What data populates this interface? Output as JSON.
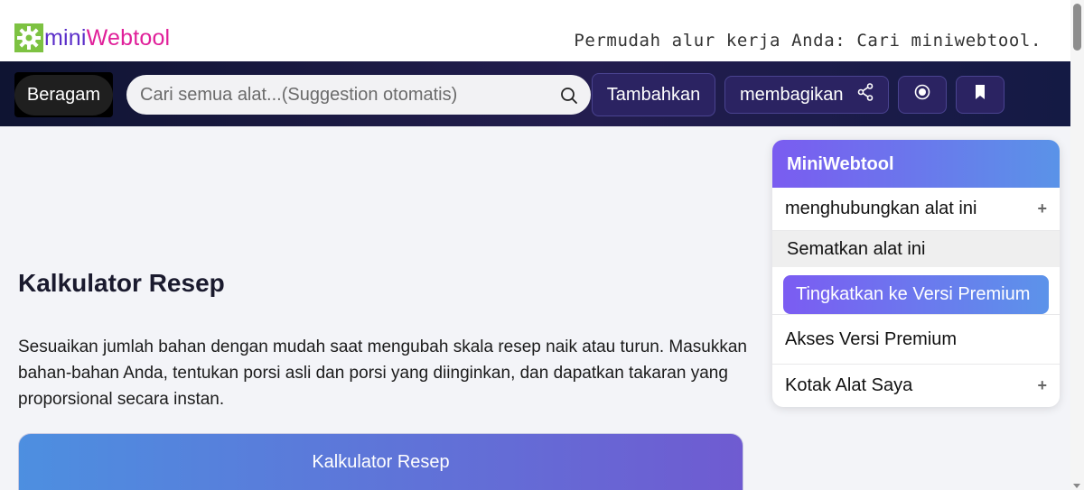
{
  "header": {
    "logo_mini": "mini",
    "logo_web": "Webtool",
    "tagline": "Permudah alur kerja Anda: Cari miniwebtool."
  },
  "nav": {
    "category_label": "Beragam",
    "search_placeholder": "Cari semua alat...(Suggestion otomatis)",
    "add_label": "Tambahkan",
    "share_label": "membagikan"
  },
  "main": {
    "title": "Kalkulator Resep",
    "description": "Sesuaikan jumlah bahan dengan mudah saat mengubah skala resep naik atau turun. Masukkan bahan-bahan Anda, tentukan porsi asli dan porsi yang diinginkan, dan dapatkan takaran yang proporsional secara instan.",
    "calculator_title": "Kalkulator Resep"
  },
  "sidebar": {
    "heading": "MiniWebtool",
    "link_tool": "menghubungkan alat ini",
    "embed_tool": "Sematkan alat ini",
    "upgrade": "Tingkatkan ke Versi Premium",
    "premium_access": "Akses Versi Premium",
    "my_toolbox": "Kotak Alat Saya",
    "expand_symbol": "+"
  },
  "colors": {
    "brand_purple": "#5b2fc9",
    "brand_pink": "#e0209a",
    "logo_green": "#7dc242",
    "nav_bg": "#1b1b45",
    "accent_gradient_start": "#7a5cf0",
    "accent_gradient_end": "#5a93e8"
  }
}
